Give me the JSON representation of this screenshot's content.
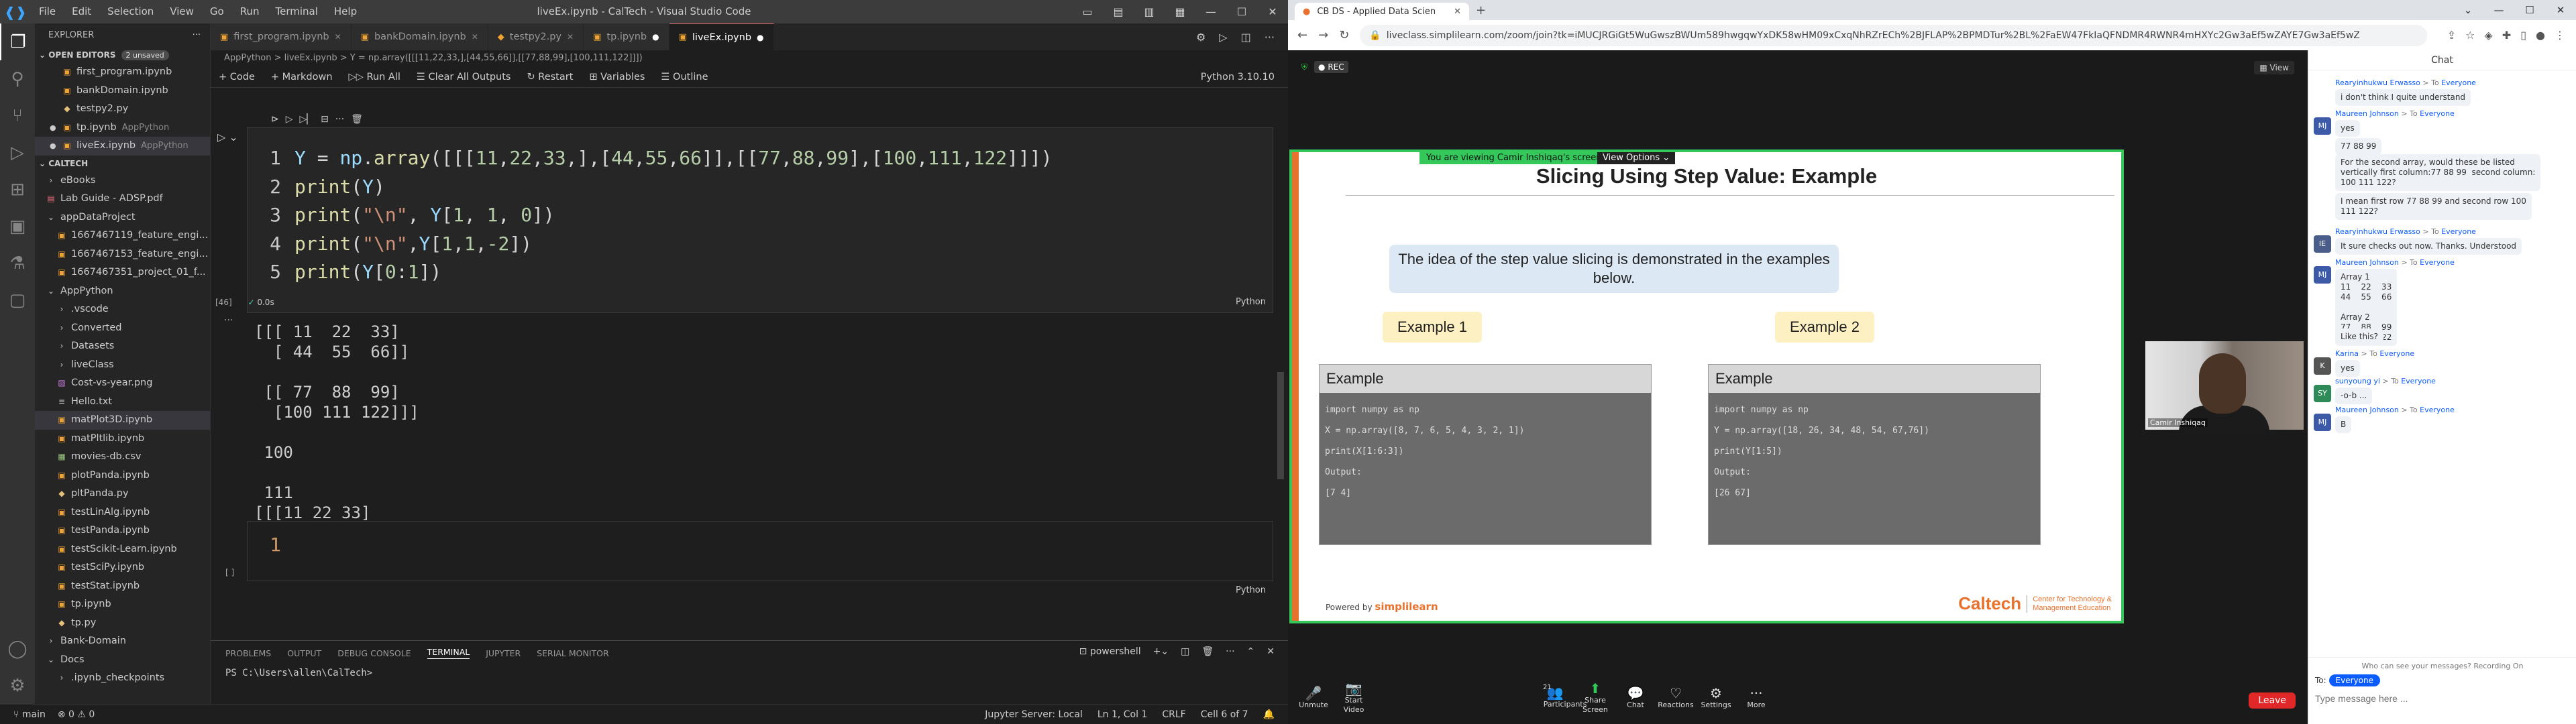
{
  "vscode": {
    "title": "liveEx.ipynb - CalTech - Visual Studio Code",
    "menu": [
      "File",
      "Edit",
      "Selection",
      "View",
      "Go",
      "Run",
      "Terminal",
      "Help"
    ],
    "explorer_label": "EXPLORER",
    "open_editors_label": "OPEN EDITORS",
    "unsaved": "2 unsaved",
    "open_editors": [
      {
        "name": "first_program.ipynb",
        "extra": ""
      },
      {
        "name": "bankDomain.ipynb",
        "extra": ""
      },
      {
        "name": "testpy2.py",
        "extra": ""
      },
      {
        "name": "tp.ipynb",
        "extra": "AppPython"
      },
      {
        "name": "liveEx.ipynb",
        "extra": "AppPython"
      }
    ],
    "workspace_label": "CALTECH",
    "tree": [
      {
        "name": "eBooks",
        "indent": 1,
        "type": "folder"
      },
      {
        "name": "Lab Guide - ADSP.pdf",
        "indent": 1,
        "type": "pdf"
      },
      {
        "name": "appDataProject",
        "indent": 1,
        "type": "folder-open"
      },
      {
        "name": "1667467119_feature_engi...",
        "indent": 2,
        "type": "file"
      },
      {
        "name": "1667467153_feature_engi...",
        "indent": 2,
        "type": "file"
      },
      {
        "name": "1667467351_project_01_f...",
        "indent": 2,
        "type": "file"
      },
      {
        "name": "AppPython",
        "indent": 1,
        "type": "folder-open"
      },
      {
        "name": ".vscode",
        "indent": 2,
        "type": "folder"
      },
      {
        "name": "Converted",
        "indent": 2,
        "type": "folder"
      },
      {
        "name": "Datasets",
        "indent": 2,
        "type": "folder"
      },
      {
        "name": "liveClass",
        "indent": 2,
        "type": "folder"
      },
      {
        "name": "Cost-vs-year.png",
        "indent": 2,
        "type": "img"
      },
      {
        "name": "Hello.txt",
        "indent": 2,
        "type": "txt"
      },
      {
        "name": "matPlot3D.ipynb",
        "indent": 2,
        "type": "nb"
      },
      {
        "name": "matPltlib.ipynb",
        "indent": 2,
        "type": "nb"
      },
      {
        "name": "movies-db.csv",
        "indent": 2,
        "type": "csv"
      },
      {
        "name": "plotPanda.ipynb",
        "indent": 2,
        "type": "nb"
      },
      {
        "name": "pltPanda.py",
        "indent": 2,
        "type": "py"
      },
      {
        "name": "testLinAlg.ipynb",
        "indent": 2,
        "type": "nb"
      },
      {
        "name": "testPanda.ipynb",
        "indent": 2,
        "type": "nb"
      },
      {
        "name": "testScikit-Learn.ipynb",
        "indent": 2,
        "type": "nb"
      },
      {
        "name": "testSciPy.ipynb",
        "indent": 2,
        "type": "nb"
      },
      {
        "name": "testStat.ipynb",
        "indent": 2,
        "type": "nb"
      },
      {
        "name": "tp.ipynb",
        "indent": 2,
        "type": "nb"
      },
      {
        "name": "tp.py",
        "indent": 2,
        "type": "py"
      },
      {
        "name": "Bank-Domain",
        "indent": 1,
        "type": "folder"
      },
      {
        "name": "Docs",
        "indent": 1,
        "type": "folder-open"
      },
      {
        "name": ".ipynb_checkpoints",
        "indent": 2,
        "type": "folder"
      }
    ],
    "tabs": [
      "first_program.ipynb",
      "bankDomain.ipynb",
      "testpy2.py",
      "tp.ipynb",
      "liveEx.ipynb"
    ],
    "breadcrumb": "AppPython  >  liveEx.ipynb  >  Y = np.array([[[11,22,33,],[44,55,66]],[[77,88,99],[100,111,122]]])",
    "toolbar": [
      "+ Code",
      "+ Markdown",
      "Run All",
      "Clear All Outputs",
      "Restart",
      "Variables",
      "Outline"
    ],
    "kernel": "Python 3.10.10",
    "cell1": {
      "exec_count": "[46]",
      "time": "0.0s",
      "lang": "Python",
      "lines": [
        "Y = np.array([[[11,22,33,],[44,55,66]],[[77,88,99],[100,111,122]]])",
        "print(Y)",
        "print(\"\\n\", Y[1, 1, 0])",
        "print(\"\\n\",Y[1,1,-2])",
        "print(Y[0:1])"
      ],
      "output": "[[[ 11  22  33]\n  [ 44  55  66]]\n\n [[ 77  88  99]\n  [100 111 122]]]\n\n 100\n\n 111\n[[[11 22 33]\n  [44 55 66]]]"
    },
    "cell2": {
      "exec_count": "[ ]",
      "line": "1",
      "lang": "Python"
    },
    "panel_tabs": [
      "PROBLEMS",
      "OUTPUT",
      "DEBUG CONSOLE",
      "TERMINAL",
      "JUPYTER",
      "SERIAL MONITOR"
    ],
    "terminal_name": "powershell",
    "terminal_line": "PS C:\\Users\\allen\\CalTech>",
    "status_left": [
      "main",
      "⊗ 0 ⚠ 0"
    ],
    "status_right": [
      "Jupyter Server: Local",
      "Ln 1, Col 1",
      "CRLF",
      "Cell 6 of 7"
    ]
  },
  "zoom": {
    "tab_title": "CB DS - Applied Data Scien",
    "url": "liveclass.simplilearn.com/zoom/join?tk=iMUCJRGiGt5WuGwszBWUm589hwgqwYxDK58wHM09xCxqNhRZrECh%2BJFLAP%2BPMDTur%2BL%2FaEW47FkIaQFNDMR4RWNR4mHXYc2Gw3aEf5wZAYE7Gw3aEf5wZ",
    "rec": "REC",
    "view": "View",
    "viewing": "You are viewing Camir Inshiqaq's screen",
    "view_options": "View Options",
    "slide": {
      "title": "Slicing Using Step Value: Example",
      "box": "The idea of the step value slicing is demonstrated in the examples below.",
      "ex1": "Example 1",
      "ex2": "Example 2",
      "card1_head": "Example",
      "card1_code": "import numpy as np\nX = np.array([8, 7, 6, 5, 4, 3, 2, 1])\nprint(X[1:6:3])\nOutput:\n[7 4]",
      "card2_head": "Example",
      "card2_code": "import numpy as np\nY = np.array([18, 26, 34, 48, 54, 67,76])\nprint(Y[1:5])\nOutput:\n[26 67]",
      "powered": "Powered by",
      "brand": "simplilearn",
      "caltech": "Caltech",
      "ctme": "Center for Technology &\nManagement Education"
    },
    "video_name": "Camir Inshiqaq",
    "toolbar": [
      "Unmute",
      "Start Video",
      "Participants",
      "Share Screen",
      "Chat",
      "Reactions",
      "Settings",
      "More"
    ],
    "participants_count": "21",
    "leave": "Leave",
    "chat": {
      "title": "Chat",
      "messages": [
        {
          "from": "Rearyinhukwu Erwasso",
          "to": "Everyone",
          "av": "",
          "text": "i don't think I quite understand"
        },
        {
          "from": "Maureen Johnson",
          "to": "Everyone",
          "av": "MJ",
          "text": "yes"
        },
        {
          "from": "",
          "to": "",
          "av": "",
          "text": "77 88 99"
        },
        {
          "from": "",
          "to": "",
          "av": "",
          "text": "For the second array, would these be listed\nvertically first column:77 88 99  second column:\n100 111 122?"
        },
        {
          "from": "",
          "to": "",
          "av": "",
          "text": "I mean first row 77 88 99 and second row 100\n111 122?"
        },
        {
          "from": "Rearyinhukwu Erwasso",
          "to": "Everyone",
          "av": "IE",
          "text": "It sure checks out now. Thanks. Understood"
        },
        {
          "from": "Maureen Johnson",
          "to": "Everyone",
          "av": "MJ",
          "text": "Array 1\n11    22    33\n44    55    66\n\nArray 2\n77    88    99\n100 111 122"
        },
        {
          "from": "",
          "to": "",
          "av": "",
          "text": "Like this?"
        },
        {
          "from": "Karina",
          "to": "Everyone",
          "av": "K",
          "text": "yes"
        },
        {
          "from": "sunyoung yi",
          "to": "Everyone",
          "av": "SY",
          "text": "-o-b ..."
        },
        {
          "from": "Maureen Johnson",
          "to": "Everyone",
          "av": "MJ",
          "text": "B"
        }
      ],
      "who_can_see": "Who can see your messages? Recording On",
      "to_label": "To:",
      "to_value": "Everyone",
      "placeholder": "Type message here ..."
    }
  }
}
